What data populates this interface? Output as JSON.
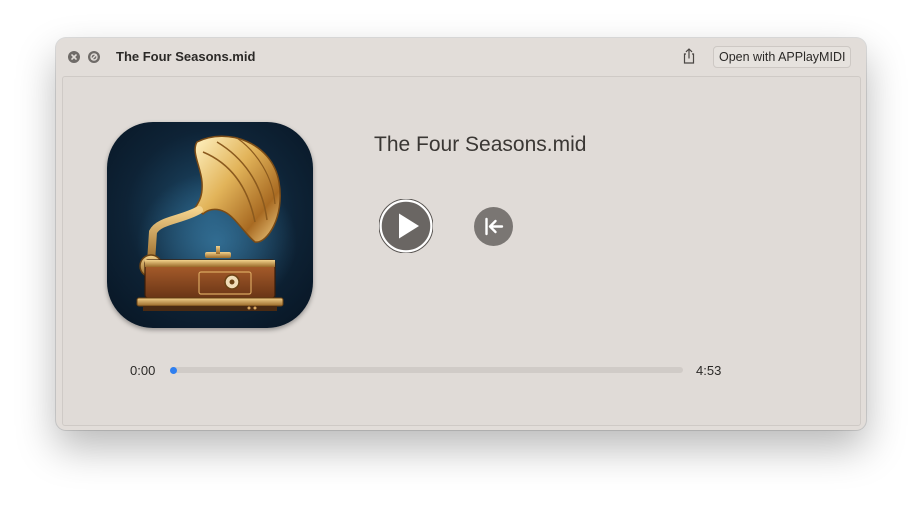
{
  "window": {
    "title": "The Four Seasons.mid",
    "close_icon": "close-icon",
    "fullscreen_icon": "fullscreen-icon",
    "share_icon": "share-icon",
    "open_with_label": "Open with APPlayMIDI"
  },
  "player": {
    "file_name": "The Four Seasons.mid",
    "app_icon": "gramophone-icon",
    "play_icon": "play-icon",
    "rewind_icon": "rewind-to-start-icon",
    "time_current": "0:00",
    "time_total": "4:53",
    "progress": 0.0,
    "progress_color": "#2f7ff0"
  }
}
